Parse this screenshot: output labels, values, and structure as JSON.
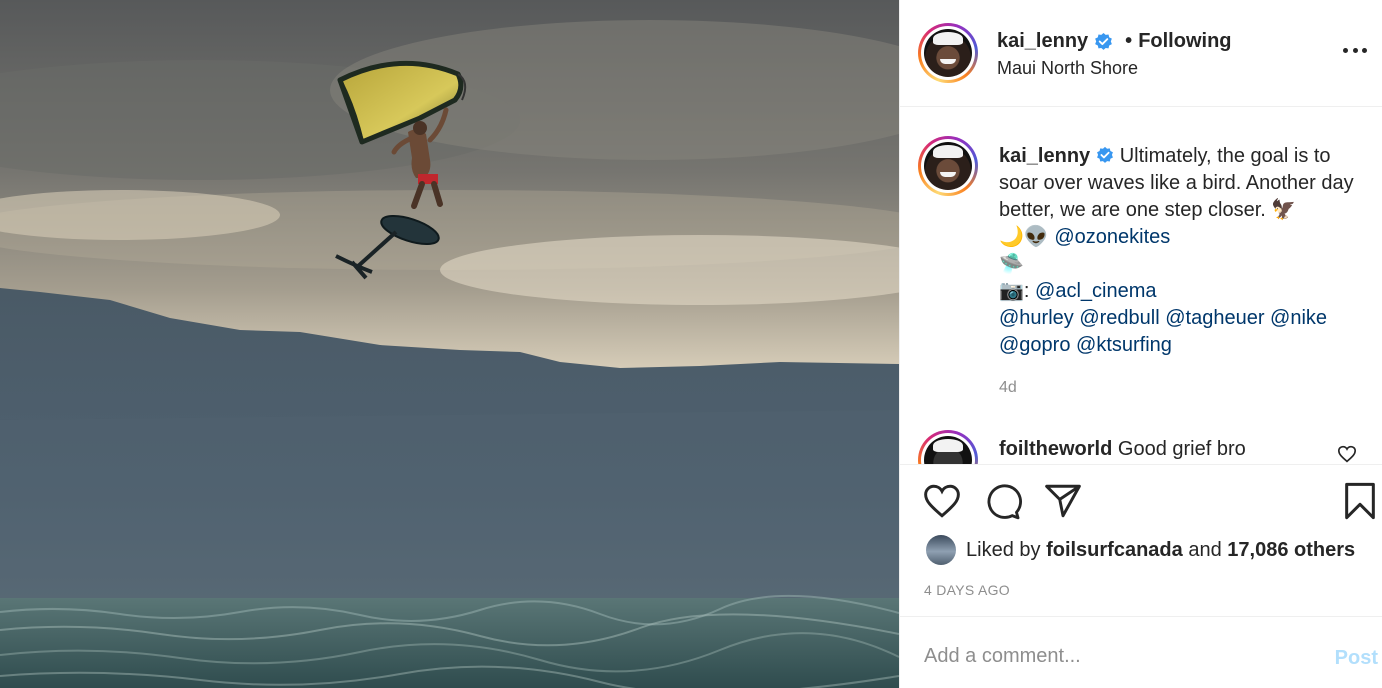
{
  "post": {
    "author": "kai_lenny",
    "follow_status": "Following",
    "separator": "•",
    "location": "Maui North Shore",
    "verified": true
  },
  "caption": {
    "username": "kai_lenny",
    "text_1": " Ultimately, the goal is to soar over waves like a bird. Another day better, we are one step closer. 🦅",
    "emoji_line_1": "🌙👽 ",
    "mention_1": "@ozonekites",
    "emoji_line_2": "🛸",
    "camera_prefix": "📷: ",
    "mention_2": "@acl_cinema",
    "tags_line_1": "@hurley @redbull @tagheuer @nike",
    "tags_line_2": "@gopro @ktsurfing",
    "time": "4d"
  },
  "comment": {
    "username": "foiltheworld",
    "text": "Good grief bro"
  },
  "likes": {
    "prefix": "Liked by ",
    "user": "foilsurfcanada",
    "middle": " and ",
    "count": "17,086 others"
  },
  "timestamp": "4 DAYS AGO",
  "add_comment": {
    "placeholder": "Add a comment...",
    "post_label": "Post"
  },
  "colors": {
    "verified_blue": "#3897f0",
    "mention": "#00376b",
    "muted": "#8e8e8e",
    "post_disabled": "#b2dffc"
  },
  "icons": [
    "more-icon",
    "verified-icon",
    "heart-icon",
    "comment-icon",
    "share-icon",
    "bookmark-icon"
  ]
}
